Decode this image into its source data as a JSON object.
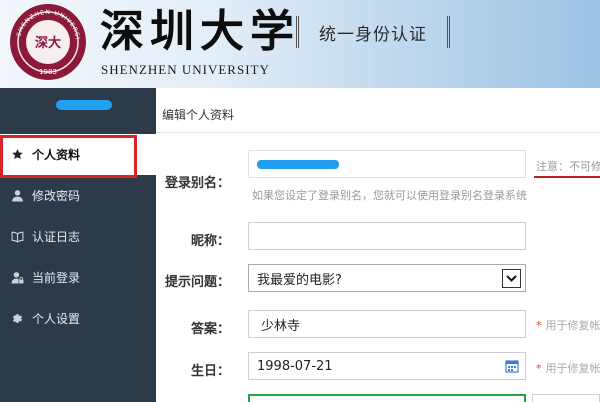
{
  "header": {
    "university_cn": "深圳大学",
    "university_en": "SHENZHEN UNIVERSITY",
    "system_title": "统一身份认证",
    "seal_text_top": "SHENZHEN UNIVERSITY",
    "seal_text_center": "深大",
    "seal_year": "1983"
  },
  "sidebar": {
    "items": [
      {
        "label": "个人资料",
        "icon": "star-icon",
        "active": true
      },
      {
        "label": "修改密码",
        "icon": "user-icon"
      },
      {
        "label": "认证日志",
        "icon": "book-icon"
      },
      {
        "label": "当前登录",
        "icon": "user-lock-icon"
      },
      {
        "label": "个人设置",
        "icon": "gear-icon"
      }
    ]
  },
  "main": {
    "page_title": "编辑个人资料",
    "form": {
      "alias": {
        "label": "登录别名：",
        "hint": "如果您设定了登录别名，您就可以使用登录别名登录系统",
        "warning": "注意：不可修"
      },
      "nickname": {
        "label": "昵称：",
        "value": ""
      },
      "question": {
        "label": "提示问题：",
        "value": "我最爱的电影?"
      },
      "answer": {
        "label": "答案：",
        "value": "少林寺",
        "note": "用于修复帐"
      },
      "birthday": {
        "label": "生日：",
        "value": "1998-07-21",
        "note": "用于修复帐"
      }
    }
  },
  "colors": {
    "sidebar_bg": "#2d3a4a",
    "active_border": "#d9252a",
    "mask_blue": "#21a0f0",
    "seal": "#8b1a3a"
  }
}
